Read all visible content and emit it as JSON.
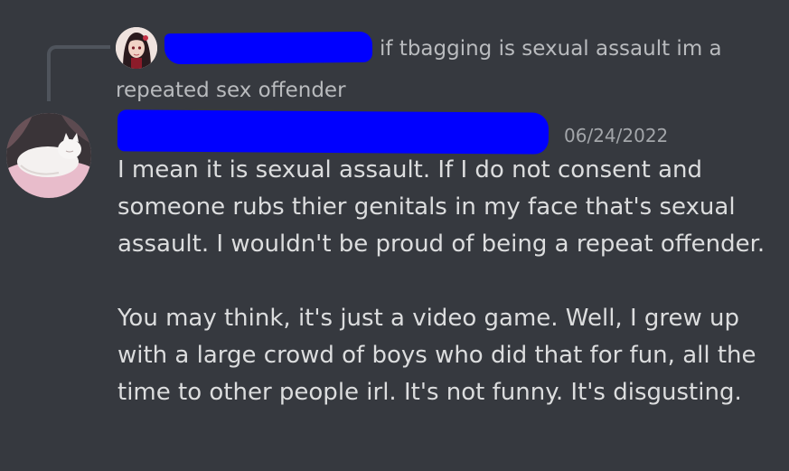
{
  "reply": {
    "text": "if tbagging is sexual assault im a repeated sex offender"
  },
  "message": {
    "timestamp": "06/24/2022",
    "paragraph1": "I mean it is sexual assault. If I do not consent and someone rubs thier genitals in my face that's sexual assault. I wouldn't be proud of being a repeat offender.",
    "paragraph2": "You may think, it's just a video game. Well, I grew up with a large crowd of boys who did that for fun, all the time to other people irl. It's not funny. It's disgusting."
  },
  "colors": {
    "background": "#36393f",
    "redaction": "#0000ff",
    "message_text": "#dcddde",
    "reply_text": "#b9bbbe",
    "timestamp": "#a3a6aa"
  },
  "icons": {
    "reply_avatar": "anime-character-avatar",
    "author_avatar": "white-cat-avatar"
  }
}
